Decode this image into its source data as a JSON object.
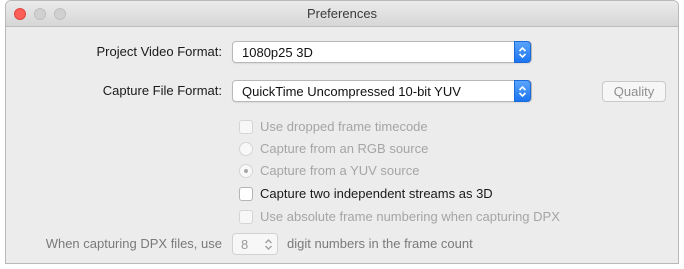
{
  "window": {
    "title": "Preferences"
  },
  "form": {
    "project_video_format": {
      "label": "Project Video Format:",
      "value": "1080p25 3D"
    },
    "capture_file_format": {
      "label": "Capture File Format:",
      "value": "QuickTime Uncompressed 10-bit YUV"
    },
    "quality_button": "Quality",
    "options": [
      {
        "type": "checkbox",
        "label": "Use dropped frame timecode",
        "checked": false,
        "enabled": false
      },
      {
        "type": "radio",
        "label": "Capture from an RGB source",
        "selected": false,
        "enabled": false
      },
      {
        "type": "radio",
        "label": "Capture from a YUV source",
        "selected": true,
        "enabled": false
      },
      {
        "type": "checkbox",
        "label": "Capture two independent streams as 3D",
        "checked": false,
        "enabled": true
      },
      {
        "type": "checkbox",
        "label": "Use absolute frame numbering when capturing DPX",
        "checked": false,
        "enabled": false
      }
    ],
    "dpx": {
      "prefix": "When capturing DPX files, use",
      "digits": "8",
      "suffix": "digit numbers in the frame count"
    }
  },
  "colors": {
    "accent": "#1b75f0",
    "close": "#fc5f57",
    "window_bg": "#ececec"
  }
}
